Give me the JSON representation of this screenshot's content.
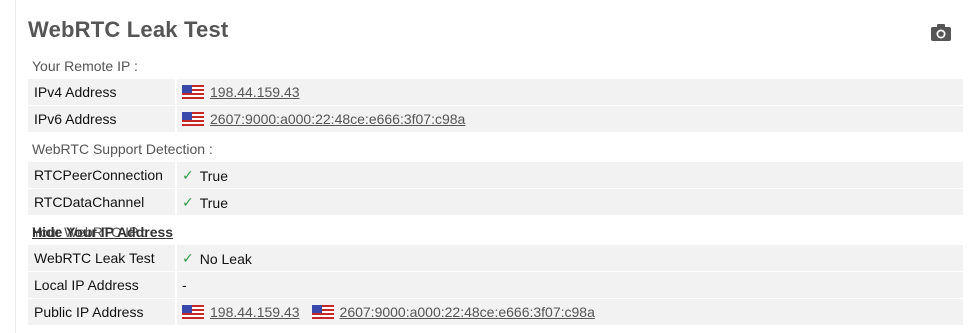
{
  "title": "WebRTC Leak Test",
  "camera_icon": "camera-icon",
  "sections": {
    "remote_ip": "Your Remote IP :",
    "support": "WebRTC Support Detection :",
    "webrtc_ip": "Your WebRTC IP :"
  },
  "hide_link": "Hide Your IP Address",
  "rows": {
    "ipv4": {
      "label": "IPv4 Address",
      "value": "198.44.159.43"
    },
    "ipv6": {
      "label": "IPv6 Address",
      "value": "2607:9000:a000:22:48ce:e666:3f07:c98a"
    },
    "peer": {
      "label": "RTCPeerConnection",
      "value": "True"
    },
    "datachannel": {
      "label": "RTCDataChannel",
      "value": "True"
    },
    "leak": {
      "label": "WebRTC Leak Test",
      "value": "No Leak"
    },
    "local": {
      "label": "Local IP Address",
      "value": "-"
    },
    "public": {
      "label": "Public IP Address",
      "value_ipv4": "198.44.159.43",
      "value_ipv6": "2607:9000:a000:22:48ce:e666:3f07:c98a"
    }
  },
  "colors": {
    "check": "#2f9e44",
    "row_bg": "#f2f2f2"
  }
}
